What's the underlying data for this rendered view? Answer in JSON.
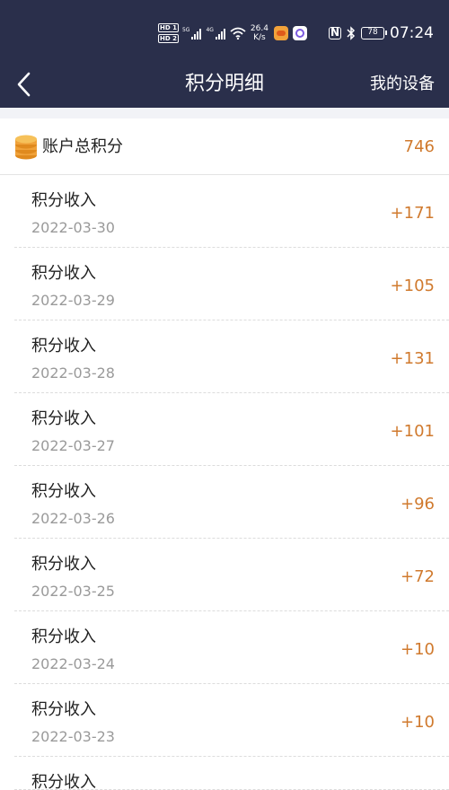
{
  "status_bar": {
    "hd_top": "HD 1",
    "hd_bottom": "HD 2",
    "sim1_tag": "5G",
    "sim2_tag": "4G",
    "speed_value": "26.4",
    "speed_unit": "K/s",
    "battery": "78",
    "time": "07:24",
    "icons": [
      "hd-icon",
      "signal-icon",
      "wifi-icon",
      "app-icon",
      "nfc-icon",
      "bluetooth-icon",
      "battery-icon"
    ]
  },
  "nav": {
    "title": "积分明细",
    "right_label": "我的设备",
    "background": "#2a2f4b"
  },
  "summary": {
    "label": "账户总积分",
    "value": "746",
    "icon": "coin-stack-icon"
  },
  "accent_color": "#d07a2e",
  "records": [
    {
      "title": "积分收入",
      "date": "2022-03-30",
      "points": "+171"
    },
    {
      "title": "积分收入",
      "date": "2022-03-29",
      "points": "+105"
    },
    {
      "title": "积分收入",
      "date": "2022-03-28",
      "points": "+131"
    },
    {
      "title": "积分收入",
      "date": "2022-03-27",
      "points": "+101"
    },
    {
      "title": "积分收入",
      "date": "2022-03-26",
      "points": "+96"
    },
    {
      "title": "积分收入",
      "date": "2022-03-25",
      "points": "+72"
    },
    {
      "title": "积分收入",
      "date": "2022-03-24",
      "points": "+10"
    },
    {
      "title": "积分收入",
      "date": "2022-03-23",
      "points": "+10"
    },
    {
      "title": "积分收入",
      "date": "",
      "points": ""
    }
  ]
}
